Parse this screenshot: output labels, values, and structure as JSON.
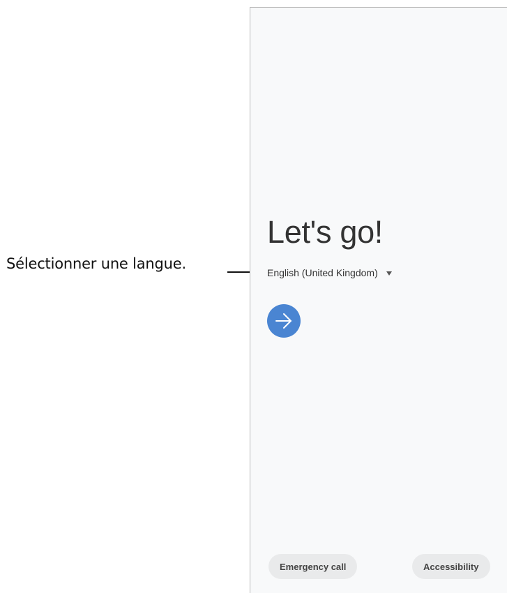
{
  "callout": {
    "text": "Sélectionner une langue."
  },
  "screen": {
    "title": "Let's go!",
    "language": {
      "selected": "English (United Kingdom)",
      "icon": "dropdown-arrow-icon"
    },
    "next_button": {
      "icon": "arrow-right-icon",
      "color": "#4a85d2"
    },
    "footer": {
      "emergency_label": "Emergency call",
      "accessibility_label": "Accessibility"
    }
  }
}
